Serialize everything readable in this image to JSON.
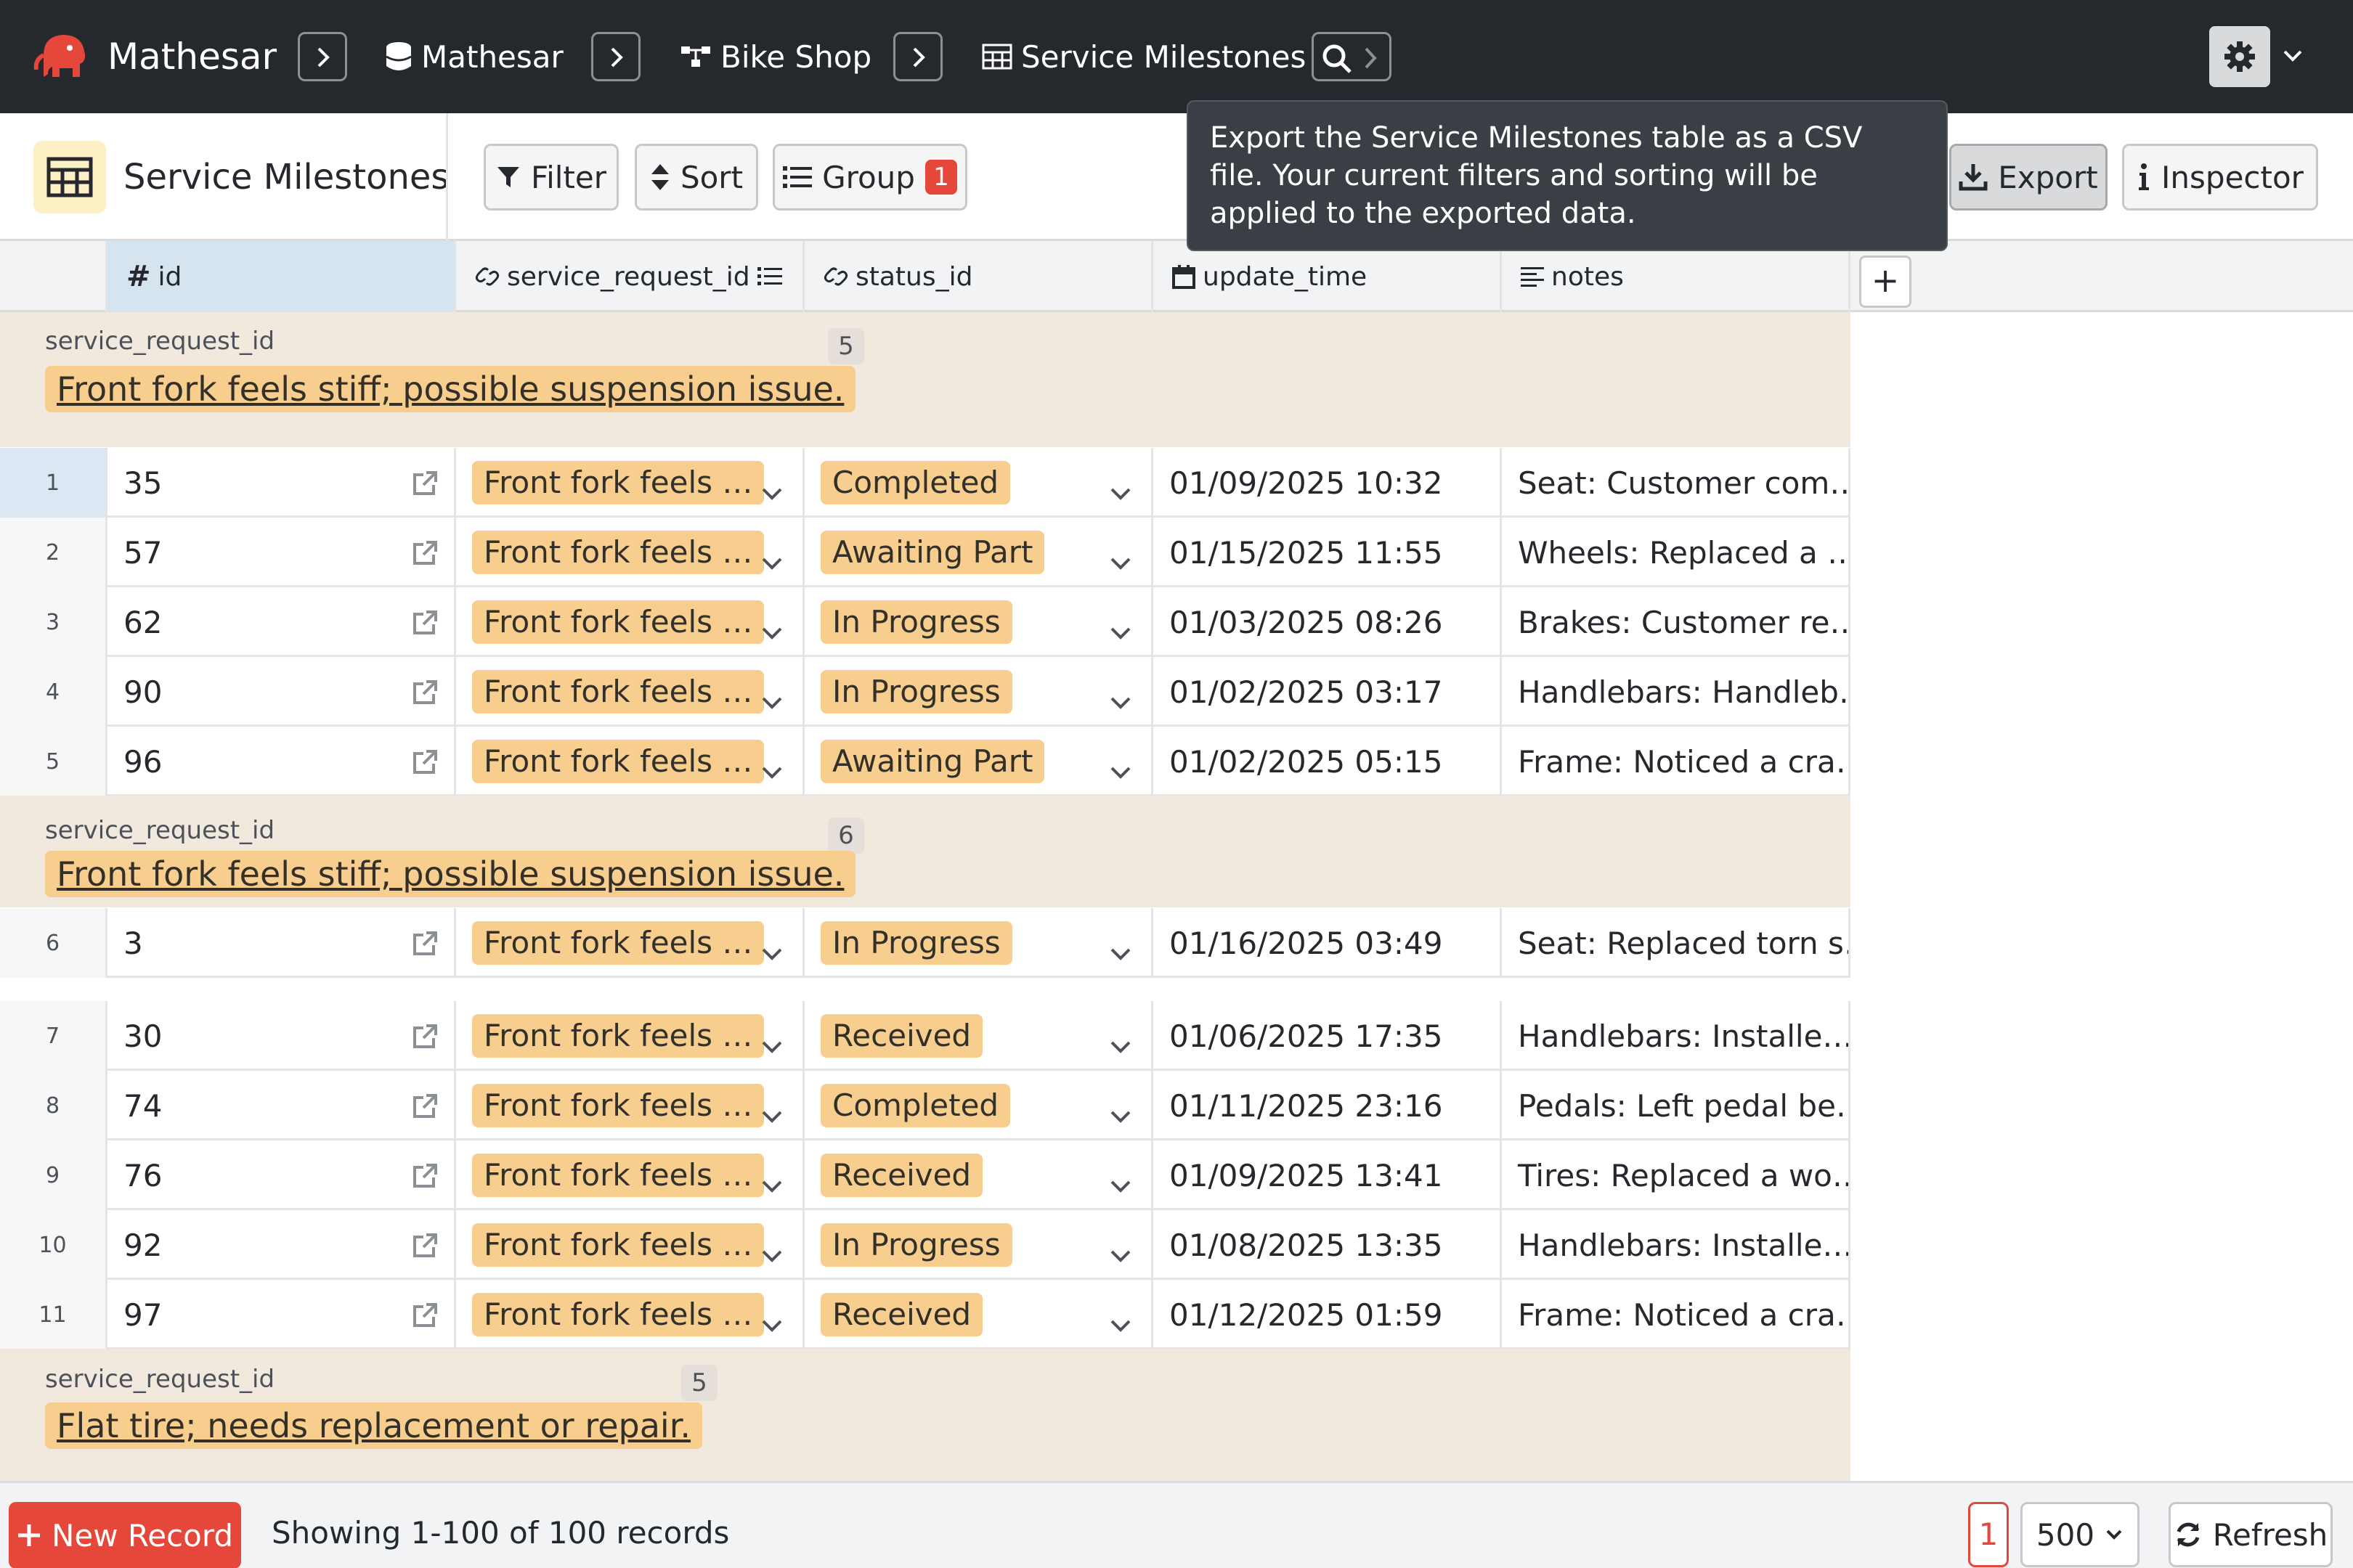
{
  "nav": {
    "app_name": "Mathesar",
    "crumbs": [
      "Mathesar",
      "Bike Shop",
      "Service Milestones"
    ]
  },
  "toolbar": {
    "table_name": "Service Milestones",
    "filter_label": "Filter",
    "sort_label": "Sort",
    "group_label": "Group",
    "group_count": "1",
    "export_label": "Export",
    "inspector_label": "Inspector"
  },
  "tooltip": {
    "text": "Export the Service Milestones table as a CSV file. Your current filters and sorting will be applied to the exported data."
  },
  "columns": [
    "id",
    "service_request_id",
    "status_id",
    "update_time",
    "notes"
  ],
  "groups": [
    {
      "label": "service_request_id",
      "count": "5",
      "value": "Front fork feels stiff; possible suspension issue.",
      "rows": [
        {
          "num": "1",
          "id": "35",
          "sr": "Front fork feels …",
          "status": "Completed",
          "time": "01/09/2025 10:32",
          "notes": "Seat: Customer com…"
        },
        {
          "num": "2",
          "id": "57",
          "sr": "Front fork feels …",
          "status": "Awaiting Part",
          "time": "01/15/2025 11:55",
          "notes": "Wheels: Replaced a …"
        },
        {
          "num": "3",
          "id": "62",
          "sr": "Front fork feels …",
          "status": "In Progress",
          "time": "01/03/2025 08:26",
          "notes": "Brakes: Customer re…"
        },
        {
          "num": "4",
          "id": "90",
          "sr": "Front fork feels …",
          "status": "In Progress",
          "time": "01/02/2025 03:17",
          "notes": "Handlebars: Handleb…"
        },
        {
          "num": "5",
          "id": "96",
          "sr": "Front fork feels …",
          "status": "Awaiting Part",
          "time": "01/02/2025 05:15",
          "notes": "Frame: Noticed a cra…"
        }
      ]
    },
    {
      "label": "service_request_id",
      "count": "6",
      "value": "Front fork feels stiff; possible suspension issue.",
      "rows": [
        {
          "num": "6",
          "id": "3",
          "sr": "Front fork feels …",
          "status": "In Progress",
          "time": "01/16/2025 03:49",
          "notes": "Seat: Replaced torn s…"
        },
        {
          "num": "7",
          "id": "30",
          "sr": "Front fork feels …",
          "status": "Received",
          "time": "01/06/2025 17:35",
          "notes": "Handlebars: Installe…"
        },
        {
          "num": "8",
          "id": "74",
          "sr": "Front fork feels …",
          "status": "Completed",
          "time": "01/11/2025 23:16",
          "notes": "Pedals: Left pedal be…"
        },
        {
          "num": "9",
          "id": "76",
          "sr": "Front fork feels …",
          "status": "Received",
          "time": "01/09/2025 13:41",
          "notes": "Tires: Replaced a wo…"
        },
        {
          "num": "10",
          "id": "92",
          "sr": "Front fork feels …",
          "status": "In Progress",
          "time": "01/08/2025 13:35",
          "notes": "Handlebars: Installe…"
        },
        {
          "num": "11",
          "id": "97",
          "sr": "Front fork feels …",
          "status": "Received",
          "time": "01/12/2025 01:59",
          "notes": "Frame: Noticed a cra…"
        }
      ]
    },
    {
      "label": "service_request_id",
      "count": "5",
      "value": "Flat tire; needs replacement or repair.",
      "rows": []
    }
  ],
  "footer": {
    "new_record_label": "New Record",
    "showing_text": "Showing 1-100 of 100 records",
    "page": "1",
    "page_size": "500",
    "refresh_label": "Refresh"
  },
  "colors": {
    "nav_bg": "#25292e",
    "group_bg": "#f1e9de",
    "chip_bg": "#f8ce8f",
    "accent_red": "#e5483a"
  }
}
